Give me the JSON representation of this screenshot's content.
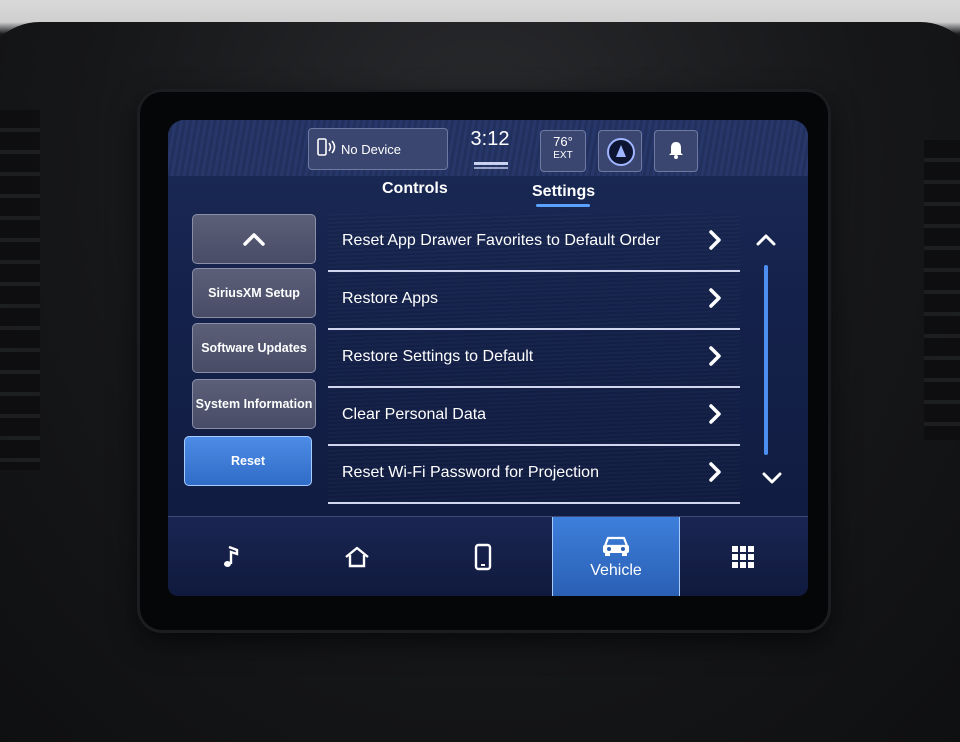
{
  "status_bar": {
    "device_label": "No Device",
    "time": "3:12",
    "temperature": "76°",
    "temperature_unit": "EXT"
  },
  "tabs": [
    {
      "label": "Controls"
    },
    {
      "label": "Settings",
      "active": true
    }
  ],
  "side_menu": [
    {
      "label": "^"
    },
    {
      "label": "SiriusXM Setup"
    },
    {
      "label": "Software Updates"
    },
    {
      "label": "System Information"
    },
    {
      "label": "Reset",
      "active": true
    }
  ],
  "reset_list": [
    {
      "label": "Reset App Drawer Favorites to Default Order"
    },
    {
      "label": "Restore Apps"
    },
    {
      "label": "Restore Settings to Default"
    },
    {
      "label": "Clear Personal Data"
    },
    {
      "label": "Reset Wi-Fi Password for Projection"
    }
  ],
  "bottom_nav": [
    {
      "icon": "music-note-icon"
    },
    {
      "icon": "home-icon"
    },
    {
      "icon": "phone-icon"
    },
    {
      "icon": "car-icon",
      "label": "Vehicle",
      "active": true
    },
    {
      "icon": "apps-grid-icon"
    }
  ],
  "colors": {
    "accent": "#3d7fdc",
    "screen_bg": "#14214a"
  }
}
